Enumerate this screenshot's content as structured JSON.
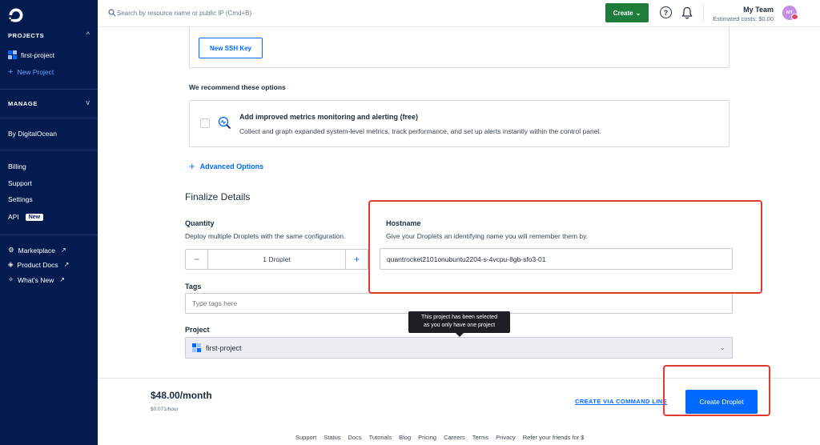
{
  "sidebar": {
    "projects_header": "PROJECTS",
    "project_name": "first-project",
    "new_project": "New Project",
    "manage_header": "MANAGE",
    "by_do": "By DigitalOcean",
    "billing": "Billing",
    "support": "Support",
    "settings": "Settings",
    "api": "API",
    "api_badge": "New",
    "marketplace": "Marketplace",
    "product_docs": "Product Docs",
    "whats_new": "What's New"
  },
  "topbar": {
    "search_placeholder": "Search by resource name or public IP (Cmd+B)",
    "create_label": "Create",
    "team_name": "My Team",
    "estimated_costs": "Estimated costs: $0.00",
    "avatar_initials": "MT"
  },
  "ssh": {
    "new_key_label": "New SSH Key"
  },
  "recommend": {
    "heading": "We recommend these options",
    "metrics_title": "Add improved metrics monitoring and alerting (free)",
    "metrics_desc": "Collect and graph expanded system-level metrics, track performance, and set up alerts instantly within the control panel."
  },
  "advanced_options": "Advanced Options",
  "finalize": {
    "title": "Finalize Details",
    "quantity_label": "Quantity",
    "quantity_desc": "Deploy multiple Droplets with the same configuration.",
    "quantity_value": "1  Droplet",
    "hostname_label": "Hostname",
    "hostname_desc": "Give your Droplets an identifying name you will remember them by.",
    "hostname_value": "quantrocket2101onubuntu2204-s-4vcpu-8gb-sfo3-01",
    "tags_label": "Tags",
    "tags_placeholder": "Type tags here",
    "project_label": "Project",
    "project_value": "first-project",
    "tooltip_line1": "This project has been selected",
    "tooltip_line2": "as you only have one project"
  },
  "pricebar": {
    "price_month": "$48.00/month",
    "price_hour": "$0.071/hour",
    "cli_link": "CREATE VIA COMMAND LINE",
    "create_droplet": "Create Droplet"
  },
  "footer": [
    "Support",
    "Status",
    "Docs",
    "Tutorials",
    "Blog",
    "Pricing",
    "Careers",
    "Terms",
    "Privacy",
    "Refer your friends for $"
  ],
  "colors": {
    "sidebar": "#031b4e",
    "accent": "#0069ff",
    "create_green": "#1e7d3a",
    "highlight_red": "#e33a2f"
  }
}
